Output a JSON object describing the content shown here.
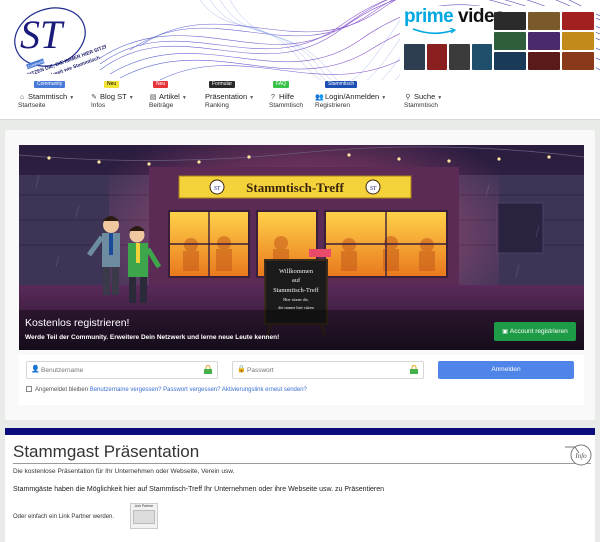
{
  "banner": {
    "logo_letters": "ST",
    "logo_arc_text": "HIER SITZEN DIE, DIE IMMER HIER SITZEN",
    "logo_arc_text2": "world weit wie Stammtisch",
    "logo_tag": "Community",
    "ad_brand_part1": "prime",
    "ad_brand_part2": "video"
  },
  "nav": {
    "items": [
      {
        "icon": "home-icon",
        "label": "Stammtisch",
        "sub": "Startseite",
        "badge": "Community",
        "badge_color": "#4a7ad8"
      },
      {
        "icon": "blog-icon",
        "label": "Blog ST",
        "sub": "Infos",
        "badge": "Neu",
        "badge_color": "#f2e337"
      },
      {
        "icon": "articles-icon",
        "label": "Artikel",
        "sub": "Beiträge",
        "badge": "Neu",
        "badge_color": "#e5333a"
      },
      {
        "icon": "",
        "label": "Präsentation",
        "sub": "Ranking",
        "badge": "Formular",
        "badge_color": "#2a2a2a"
      },
      {
        "icon": "help-icon",
        "label": "Hilfe",
        "sub": "Stammtisch",
        "badge": "FAQ",
        "badge_color": "#39c24a"
      },
      {
        "icon": "user-icon",
        "label": "Login/Anmelden",
        "sub": "Registrieren",
        "badge": "Stammtisch",
        "badge_color": "#1e4fb3"
      },
      {
        "icon": "search-icon",
        "label": "Suche",
        "sub": "Stammtisch",
        "badge": "",
        "badge_color": ""
      }
    ]
  },
  "hero": {
    "sign": "Stammtisch-Treff",
    "board_lines": [
      "Willkommen",
      "auf",
      "Stammtisch-Treff",
      "Hier sitzen die,",
      "die immer hier sitzen"
    ],
    "title": "Kostenlos registrieren!",
    "subtitle": "Werde Teil der Community. Erweitere Dein Netzwerk und lerne neue Leute kennen!",
    "register_button": "Account registrieren"
  },
  "login": {
    "username_placeholder": "Benutzername",
    "password_placeholder": "Passwort",
    "login_button": "Anmelden",
    "remember_label": "Angemeldet bleiben",
    "forgot_user": "Benutzername vergessen?",
    "forgot_pass": "Passwort vergessen?",
    "resend": "Aktivierungslink erneut senden?"
  },
  "stammgast": {
    "title": "Stammgast Präsentation",
    "p1": "Die kostenlose Präsentation für Ihr Unternehmen oder Webseite, Verein usw.",
    "p2": "Stammgäste haben die Möglichkeit hier auf Stammtisch-Treff Ihr Unternehmen oder ihre Webseite usw. zu Präsentieren",
    "p3": "Oder einfach ein Link Partner werden.",
    "partner_label": "Link Partner",
    "info_badge": "Info"
  }
}
